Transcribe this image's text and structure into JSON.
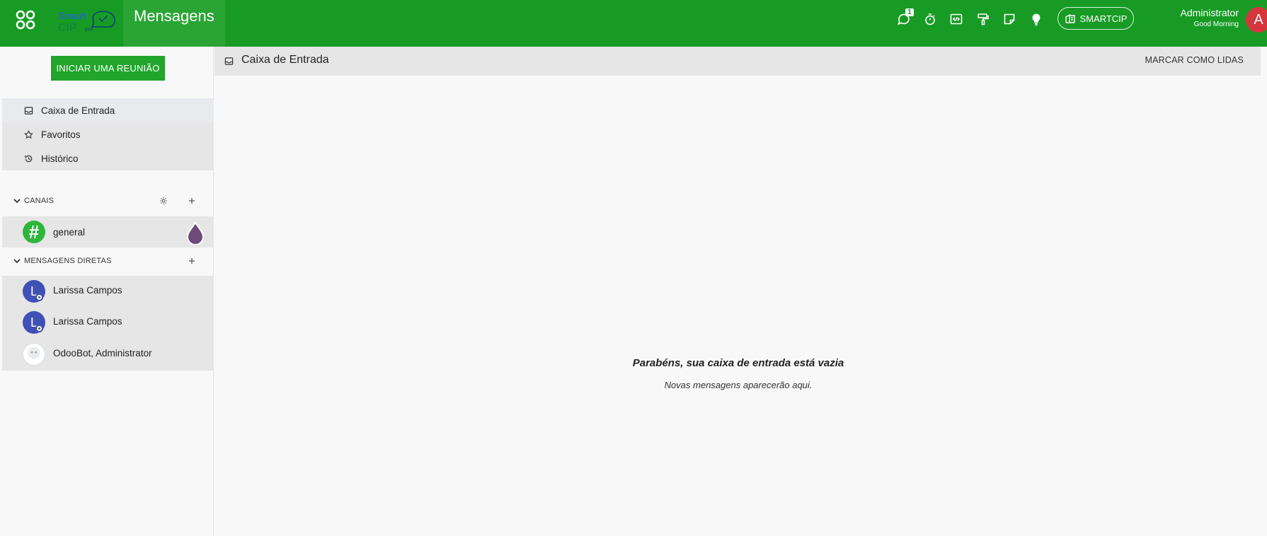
{
  "navbar": {
    "app_title": "Mensagens",
    "brand_text": "SmartCIP ERP",
    "messages_badge": "1",
    "company_button": "SMARTCIP",
    "user_name": "Administrator",
    "user_greeting": "Good Morning",
    "user_initial": "A",
    "icons": [
      "apps-icon",
      "messages-icon",
      "stopwatch-icon",
      "code-icon",
      "paint-roller-icon",
      "sticky-note-icon",
      "lightbulb-icon",
      "building-icon"
    ]
  },
  "sidebar": {
    "meeting_button": "INICIAR UMA REUNIÃO",
    "mailboxes": [
      {
        "label": "Caixa de Entrada",
        "icon": "inbox-icon"
      },
      {
        "label": "Favoritos",
        "icon": "star-icon"
      },
      {
        "label": "Histórico",
        "icon": "history-icon"
      }
    ],
    "channels_header": "CANAIS",
    "channels": [
      {
        "name": "general",
        "avatar": "#"
      }
    ],
    "dm_header": "MENSAGENS DIRETAS",
    "direct_messages": [
      {
        "name": "Larissa Campos",
        "initial": "L"
      },
      {
        "name": "Larissa Campos",
        "initial": "L"
      },
      {
        "name": "OdooBot, Administrator",
        "initial": ""
      }
    ]
  },
  "main": {
    "title": "Caixa de Entrada",
    "mark_read": "MARCAR COMO LIDAS",
    "empty_title": "Parabéns, sua caixa de entrada está vazia",
    "empty_subtitle": "Novas mensagens aparecerão aqui."
  },
  "colors": {
    "navbar": "#179b24",
    "accent": "#21a52b",
    "avatar_user": "#d5363d",
    "avatar_dm": "#3f51b5"
  }
}
